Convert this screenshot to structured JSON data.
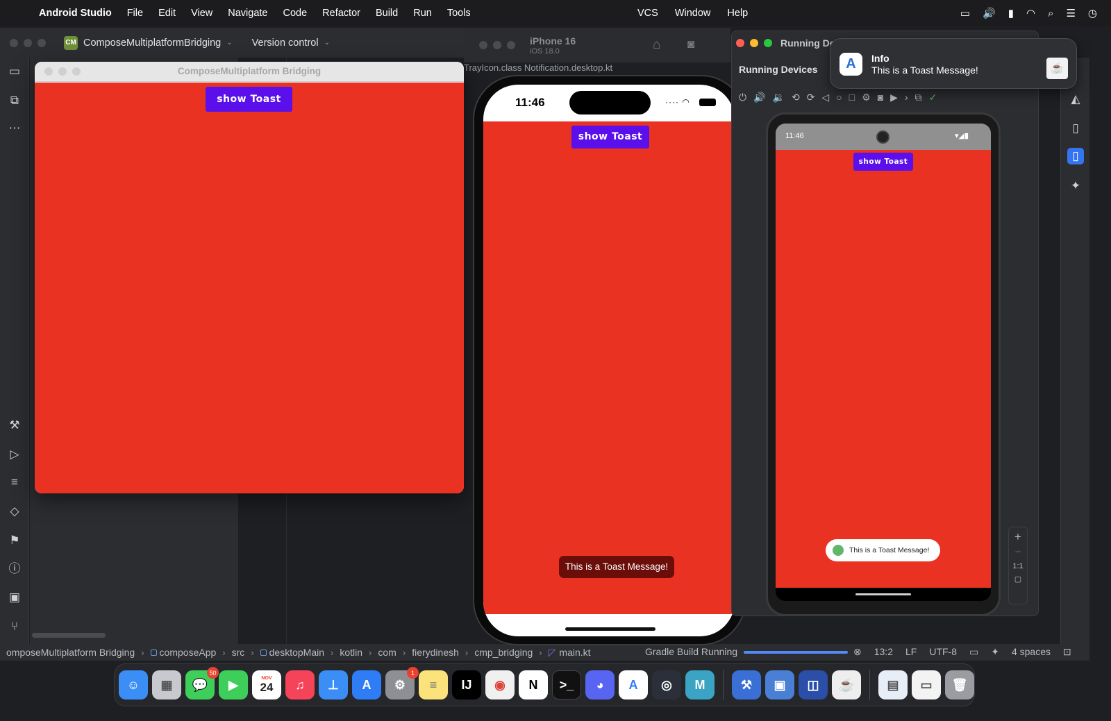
{
  "menubar": {
    "app_name": "Android Studio",
    "items": [
      "File",
      "Edit",
      "View",
      "Navigate",
      "Code",
      "Refactor",
      "Build",
      "Run",
      "Tools"
    ],
    "right_items": [
      "VCS",
      "Window",
      "Help"
    ]
  },
  "ide": {
    "project_badge": "CM",
    "project_name": "ComposeMultiplatformBridging",
    "version_control": "Version control",
    "tab_fragment": "TrayIcon.class    Notification.desktop.kt"
  },
  "desktop_window": {
    "title": "ComposeMultiplatform Bridging",
    "button_label": "show Toast",
    "content_color": "#e93222",
    "button_color": "#5b0fea"
  },
  "ios_simulator": {
    "device_name": "iPhone 16",
    "os_version": "iOS 18.0",
    "time": "11:46",
    "button_label": "show Toast",
    "toast_text": "This is a Toast Message!"
  },
  "running_devices": {
    "window_title": "Running De",
    "tab_title": "Running Devices",
    "android_time": "11:46",
    "button_label": "show Toast",
    "toast_text": "This is a Toast Message!",
    "zoom_label": "1:1"
  },
  "notification": {
    "title": "Info",
    "body": "This is a Toast Message!"
  },
  "statusbar": {
    "breadcrumbs": [
      "omposeMultiplatform Bridging",
      "composeApp",
      "src",
      "desktopMain",
      "kotlin",
      "com",
      "fierydinesh",
      "cmp_bridging",
      "main.kt"
    ],
    "gradle_status": "Gradle Build Running",
    "cursor_position": "13:2",
    "line_ending": "LF",
    "encoding": "UTF-8",
    "indent": "4 spaces"
  },
  "dock": {
    "messages_badge": "50",
    "calendar_month": "NOV",
    "calendar_day": "24",
    "settings_badge": "1"
  }
}
